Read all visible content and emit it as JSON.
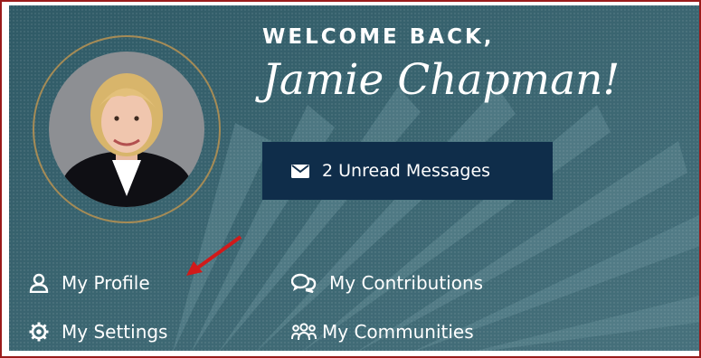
{
  "welcome": {
    "greeting": "WELCOME BACK,",
    "name": "Jamie Chapman!"
  },
  "messages_button": {
    "icon": "envelope-icon",
    "label": "2 Unread Messages"
  },
  "links": {
    "profile": {
      "icon": "user-icon",
      "label": "My Profile"
    },
    "contributions": {
      "icon": "comments-icon",
      "label": "My Contributions"
    },
    "settings": {
      "icon": "gear-icon",
      "label": "My Settings"
    },
    "communities": {
      "icon": "users-icon",
      "label": "My Communities"
    }
  },
  "colors": {
    "panel_bg": "#3c6470",
    "button_bg": "#0f2d4a",
    "ring": "#a58b56",
    "frame": "#9b1c1c",
    "arrow": "#d11a1a"
  }
}
